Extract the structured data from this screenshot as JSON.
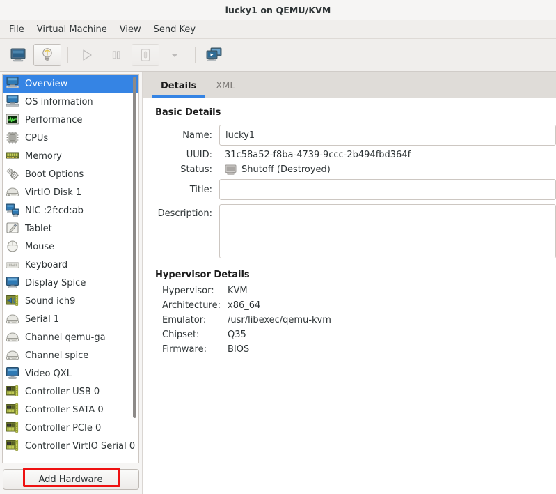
{
  "window": {
    "title": "lucky1 on QEMU/KVM"
  },
  "menubar": {
    "items": [
      {
        "label": "File",
        "name": "menu-file"
      },
      {
        "label": "Virtual Machine",
        "name": "menu-virtual-machine"
      },
      {
        "label": "View",
        "name": "menu-view"
      },
      {
        "label": "Send Key",
        "name": "menu-send-key"
      }
    ]
  },
  "toolbar": {
    "buttons": [
      {
        "icon": "console-monitor-icon",
        "name": "show-graphical-console-button",
        "enabled": true,
        "framed": false
      },
      {
        "icon": "lightbulb-icon",
        "name": "show-virtual-hardware-details-button",
        "enabled": true,
        "framed": true,
        "highlighted": true
      },
      {
        "icon": "play-triangle-icon",
        "name": "run-button",
        "enabled": false,
        "framed": false
      },
      {
        "icon": "pause-bars-icon",
        "name": "pause-button",
        "enabled": false,
        "framed": false
      },
      {
        "icon": "shutdown-icon",
        "name": "shutdown-button",
        "enabled": false,
        "framed": true
      },
      {
        "icon": "chevron-down-icon",
        "name": "shutdown-options-dropdown",
        "enabled": false,
        "framed": false
      },
      {
        "icon": "snapshots-icon",
        "name": "manage-snapshots-button",
        "enabled": true,
        "framed": false
      }
    ]
  },
  "sidebar": {
    "scroll": {
      "thumb_visible": true
    },
    "selected_index": 0,
    "items": [
      {
        "label": "Overview",
        "icon": "computer-icon",
        "name": "sidebar-item-overview"
      },
      {
        "label": "OS information",
        "icon": "computer-icon",
        "name": "sidebar-item-os-information"
      },
      {
        "label": "Performance",
        "icon": "performance-graph-icon",
        "name": "sidebar-item-performance"
      },
      {
        "label": "CPUs",
        "icon": "cpu-chip-icon",
        "name": "sidebar-item-cpus"
      },
      {
        "label": "Memory",
        "icon": "memory-stick-icon",
        "name": "sidebar-item-memory"
      },
      {
        "label": "Boot Options",
        "icon": "gears-icon",
        "name": "sidebar-item-boot-options"
      },
      {
        "label": "VirtIO Disk 1",
        "icon": "harddisk-icon",
        "name": "sidebar-item-virtio-disk-1"
      },
      {
        "label": "NIC :2f:cd:ab",
        "icon": "network-icon",
        "name": "sidebar-item-nic"
      },
      {
        "label": "Tablet",
        "icon": "tablet-pen-icon",
        "name": "sidebar-item-tablet"
      },
      {
        "label": "Mouse",
        "icon": "mouse-icon",
        "name": "sidebar-item-mouse"
      },
      {
        "label": "Keyboard",
        "icon": "keyboard-icon",
        "name": "sidebar-item-keyboard"
      },
      {
        "label": "Display Spice",
        "icon": "display-icon",
        "name": "sidebar-item-display-spice"
      },
      {
        "label": "Sound ich9",
        "icon": "sound-card-icon",
        "name": "sidebar-item-sound-ich9"
      },
      {
        "label": "Serial 1",
        "icon": "serial-port-icon",
        "name": "sidebar-item-serial-1"
      },
      {
        "label": "Channel qemu-ga",
        "icon": "serial-port-icon",
        "name": "sidebar-item-channel-qemu-ga"
      },
      {
        "label": "Channel spice",
        "icon": "serial-port-icon",
        "name": "sidebar-item-channel-spice"
      },
      {
        "label": "Video QXL",
        "icon": "display-icon",
        "name": "sidebar-item-video-qxl"
      },
      {
        "label": "Controller USB 0",
        "icon": "expansion-card-icon",
        "name": "sidebar-item-controller-usb-0"
      },
      {
        "label": "Controller SATA 0",
        "icon": "expansion-card-icon",
        "name": "sidebar-item-controller-sata-0"
      },
      {
        "label": "Controller PCIe 0",
        "icon": "expansion-card-icon",
        "name": "sidebar-item-controller-pcie-0"
      },
      {
        "label": "Controller VirtIO Serial 0",
        "icon": "expansion-card-icon",
        "name": "sidebar-item-controller-virtio-serial-0"
      }
    ],
    "add_hardware_label": "Add Hardware"
  },
  "tabs": [
    {
      "label": "Details",
      "active": true,
      "name": "tab-details"
    },
    {
      "label": "XML",
      "active": false,
      "name": "tab-xml"
    }
  ],
  "details": {
    "basic_details_title": "Basic Details",
    "name_label": "Name:",
    "name_value": "lucky1",
    "uuid_label": "UUID:",
    "uuid_value": "31c58a52-f8ba-4739-9ccc-2b494fbd364f",
    "status_label": "Status:",
    "status_value": "Shutoff (Destroyed)",
    "status_icon": "shutoff-monitor-icon",
    "title_label": "Title:",
    "title_value": "",
    "description_label": "Description:",
    "description_value": "",
    "hypervisor_details_title": "Hypervisor Details",
    "hypervisor_label": "Hypervisor:",
    "hypervisor_value": "KVM",
    "architecture_label": "Architecture:",
    "architecture_value": "x86_64",
    "emulator_label": "Emulator:",
    "emulator_value": "/usr/libexec/qemu-kvm",
    "chipset_label": "Chipset:",
    "chipset_value": "Q35",
    "firmware_label": "Firmware:",
    "firmware_value": "BIOS"
  },
  "colors": {
    "selection_blue": "#3584e4",
    "highlight_red": "#ee1111",
    "window_bg": "#f6f5f4",
    "panel_bg": "#ffffff"
  }
}
